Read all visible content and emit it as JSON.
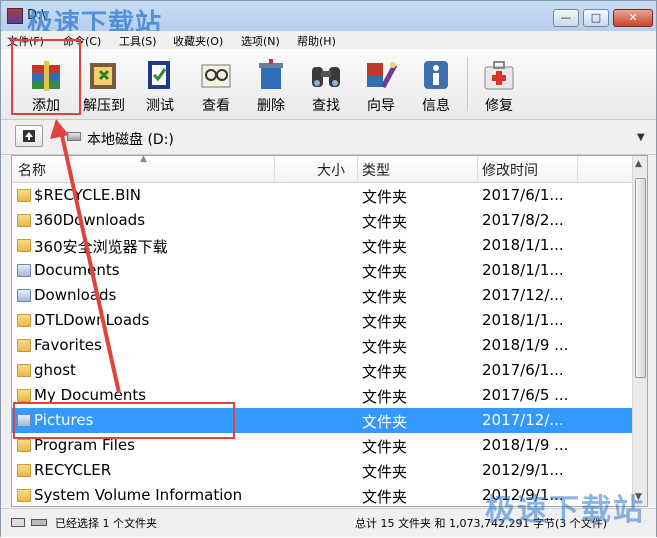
{
  "window": {
    "title": "D:\\",
    "controls": {
      "min": "—",
      "max": "□",
      "close": "✕"
    }
  },
  "watermark": {
    "top": "极速下载站",
    "bottom": "极速下载站"
  },
  "menu": [
    "文件(F)",
    "命令(C)",
    "工具(S)",
    "收藏夹(O)",
    "选项(N)",
    "帮助(H)"
  ],
  "toolbar": [
    {
      "label": "添加",
      "icon": "add-archive-icon"
    },
    {
      "label": "解压到",
      "icon": "extract-to-icon"
    },
    {
      "label": "测试",
      "icon": "test-icon"
    },
    {
      "label": "查看",
      "icon": "view-icon"
    },
    {
      "label": "删除",
      "icon": "delete-icon"
    },
    {
      "label": "查找",
      "icon": "find-icon"
    },
    {
      "label": "向导",
      "icon": "wizard-icon"
    },
    {
      "label": "信息",
      "icon": "info-icon"
    },
    {
      "label": "修复",
      "icon": "repair-icon"
    }
  ],
  "address": {
    "text": "本地磁盘 (D:)"
  },
  "columns": {
    "name": "名称",
    "size": "大小",
    "type": "类型",
    "modified": "修改时间"
  },
  "rows": [
    {
      "name": "$RECYCLE.BIN",
      "type": "文件夹",
      "modified": "2017/6/1..."
    },
    {
      "name": "360Downloads",
      "type": "文件夹",
      "modified": "2017/8/2..."
    },
    {
      "name": "360安全浏览器下载",
      "type": "文件夹",
      "modified": "2018/1/1..."
    },
    {
      "name": "Documents",
      "type": "文件夹",
      "modified": "2018/1/1..."
    },
    {
      "name": "Downloads",
      "type": "文件夹",
      "modified": "2017/12/..."
    },
    {
      "name": "DTLDownLoads",
      "type": "文件夹",
      "modified": "2018/1/1..."
    },
    {
      "name": "Favorites",
      "type": "文件夹",
      "modified": "2018/1/9 ..."
    },
    {
      "name": "ghost",
      "type": "文件夹",
      "modified": "2017/6/1..."
    },
    {
      "name": "My Documents",
      "type": "文件夹",
      "modified": "2017/6/5 ..."
    },
    {
      "name": "Pictures",
      "type": "文件夹",
      "modified": "2017/12/...",
      "selected": true
    },
    {
      "name": "Program Files",
      "type": "文件夹",
      "modified": "2018/1/9 ..."
    },
    {
      "name": "RECYCLER",
      "type": "文件夹",
      "modified": "2012/9/1..."
    },
    {
      "name": "System Volume Information",
      "type": "文件夹",
      "modified": "2012/9/1..."
    }
  ],
  "status": {
    "left": "已经选择 1 个文件夹",
    "right": "总计 15 文件夹 和 1,073,742,291 字节(3 个文件)"
  }
}
